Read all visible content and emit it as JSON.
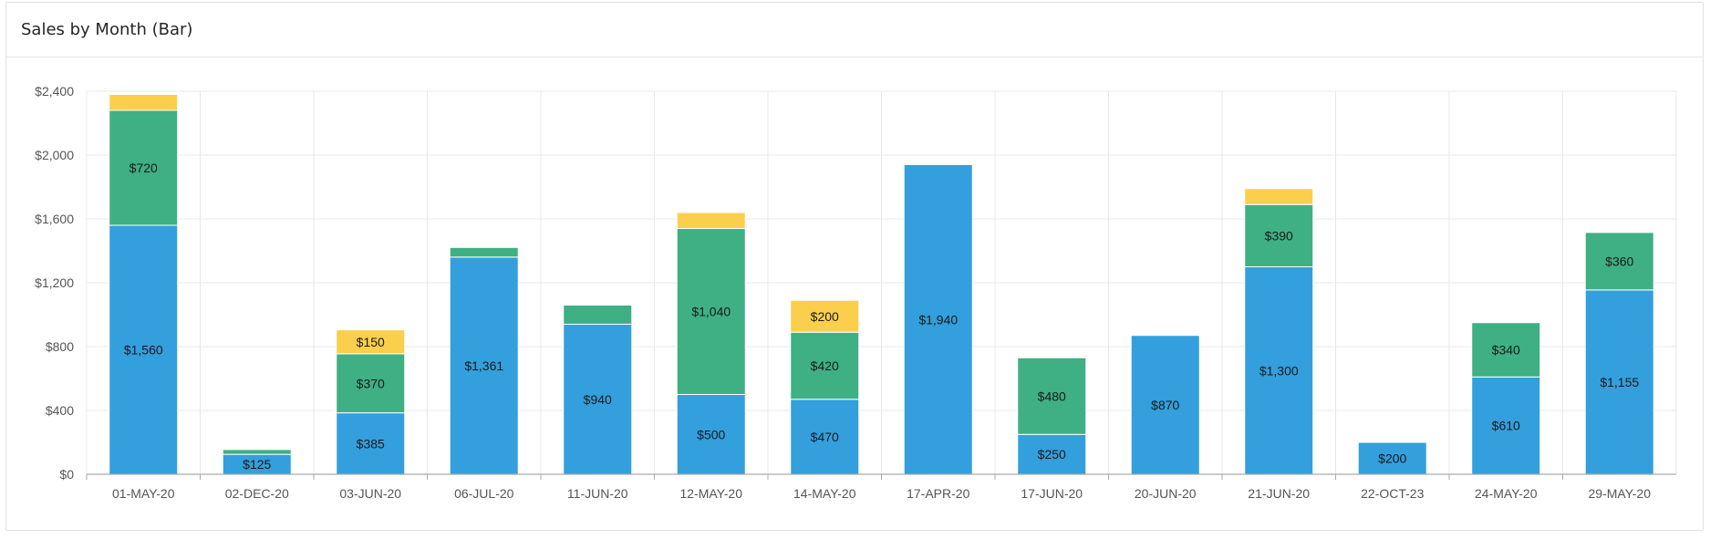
{
  "title": "Sales by Month (Bar)",
  "colors": {
    "blue": "#339fdd",
    "green": "#3eb084",
    "yellow": "#fbcf4c",
    "grid": "#e8e8e8",
    "axis": "#aaaaaa"
  },
  "chart_data": {
    "type": "bar",
    "stacked": true,
    "title": "Sales by Month (Bar)",
    "xlabel": "",
    "ylabel": "",
    "ylim": [
      0,
      2400
    ],
    "yticks": [
      0,
      400,
      800,
      1200,
      1600,
      2000,
      2400
    ],
    "ytick_labels": [
      "$0",
      "$400",
      "$800",
      "$1,200",
      "$1,600",
      "$2,000",
      "$2,400"
    ],
    "grid": true,
    "categories": [
      "01-MAY-20",
      "02-DEC-20",
      "03-JUN-20",
      "06-JUL-20",
      "11-JUN-20",
      "12-MAY-20",
      "14-MAY-20",
      "17-APR-20",
      "17-JUN-20",
      "20-JUN-20",
      "21-JUN-20",
      "22-OCT-23",
      "24-MAY-20",
      "29-MAY-20"
    ],
    "series": [
      {
        "color": "#339fdd",
        "values": [
          1560,
          125,
          385,
          1361,
          940,
          500,
          470,
          1940,
          250,
          870,
          1300,
          200,
          610,
          1155
        ],
        "labels": [
          "$1,560",
          "$125",
          "$385",
          "$1,361",
          "$940",
          "$500",
          "$470",
          "$1,940",
          "$250",
          "$870",
          "$1,300",
          "$200",
          "$610",
          "$1,155"
        ]
      },
      {
        "color": "#3eb084",
        "values": [
          720,
          30,
          370,
          60,
          120,
          1040,
          420,
          0,
          480,
          0,
          390,
          0,
          340,
          360
        ],
        "labels": [
          "$720",
          "",
          "$370",
          "",
          "",
          "$1,040",
          "$420",
          "",
          "$480",
          "",
          "$390",
          "",
          "$340",
          "$360"
        ]
      },
      {
        "color": "#fbcf4c",
        "values": [
          100,
          0,
          150,
          0,
          0,
          100,
          200,
          0,
          0,
          0,
          100,
          0,
          0,
          0
        ],
        "labels": [
          "",
          "",
          "$150",
          "",
          "",
          "",
          "$200",
          "",
          "",
          "",
          "",
          "",
          "",
          ""
        ]
      }
    ]
  }
}
